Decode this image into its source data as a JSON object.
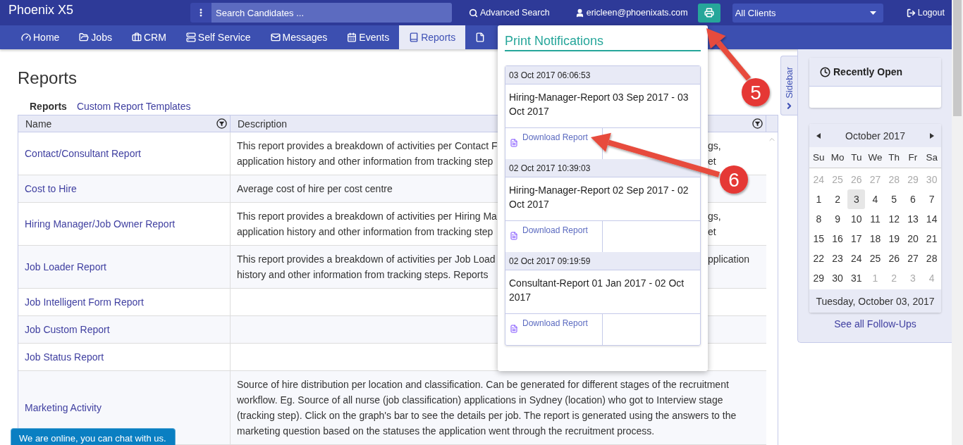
{
  "app": {
    "title": "Phoenix X5"
  },
  "top_bar": {
    "search": {
      "placeholder": "Search Candidates ..."
    },
    "advanced_search": "Advanced Search",
    "user": "ericleen@phoenixats.com",
    "client_select": {
      "value": "All Clients"
    },
    "logout": "Logout"
  },
  "nav": [
    {
      "label": "Home",
      "kind": "dashboard",
      "selected": false
    },
    {
      "label": "Jobs",
      "kind": "folder",
      "selected": false
    },
    {
      "label": "CRM",
      "kind": "briefcase",
      "selected": false
    },
    {
      "label": "Self Service",
      "kind": "server",
      "selected": false
    },
    {
      "label": "Messages",
      "kind": "mail",
      "selected": false
    },
    {
      "label": "Events",
      "kind": "calendar",
      "selected": false
    },
    {
      "label": "Reports",
      "kind": "book",
      "selected": true
    },
    {
      "kind": "file",
      "selected": false
    }
  ],
  "page": {
    "title": "Reports",
    "subtabs": [
      {
        "label": "Reports",
        "selected": true
      },
      {
        "label": "Custom Report Templates",
        "selected": false
      }
    ]
  },
  "table": {
    "columns": [
      "Name",
      "Description"
    ],
    "rows": [
      {
        "name": "Contact/Consultant Report",
        "description_fragments": [
          {
            "left": "This report provides a breakdown of activities per Contact F",
            "right": "gs,"
          },
          {
            "left": "application history and other information from tracking step",
            "right": "et"
          }
        ]
      },
      {
        "name": "Cost to Hire",
        "description": "Average cost of hire per cost centre"
      },
      {
        "name": "Hiring Manager/Job Owner Report",
        "description_fragments": [
          {
            "left": "This report provides a breakdown of activities per Hiring Ma",
            "right": "gs,"
          },
          {
            "left": "application history and other information from tracking step",
            "right": "et"
          }
        ]
      },
      {
        "name": "Job Loader Report",
        "description_fragments": [
          {
            "left": "This report provides a breakdown of activities per Job Load",
            "right": "pplication"
          },
          {
            "left": "history and other information from tracking steps. Reports"
          }
        ]
      },
      {
        "name": "Job Intelligent Form Report"
      },
      {
        "name": "Job Custom Report"
      },
      {
        "name": "Job Status Report"
      },
      {
        "name": "Marketing Activity",
        "description": "Source of hire distribution per location and classification. Can be generated for different stages of the recruitment workflow. Eg. Source of all nurse (job classification) applications in Sydney (location) who got to Interview stage (tracking step). Click on the graph's bar to see the details per job. The report is generated using the answers to the marketing question based on the statuses the application went through the recruitment process."
      }
    ]
  },
  "print_notifications": {
    "title": "Print Notifications",
    "items": [
      {
        "date": "03 Oct 2017 06:06:53",
        "title": "Hiring-Manager-Report 03 Sep 2017 - 03 Oct 2017",
        "link": "Download Report"
      },
      {
        "date": "02 Oct 2017 10:39:03",
        "title": "Hiring-Manager-Report 02 Sep 2017 - 02 Oct 2017",
        "link": "Download Report"
      },
      {
        "date": "02 Oct 2017 09:19:59",
        "title": "Consultant-Report 01 Jan 2017 - 02 Oct 2017",
        "link": "Download Report"
      }
    ]
  },
  "sidebar": {
    "tab": "Sidebar",
    "recently_open": {
      "title": "Recently Open"
    },
    "calendar": {
      "month": "October 2017",
      "weekdays": [
        "Su",
        "Mo",
        "Tu",
        "We",
        "Th",
        "Fr",
        "Sa"
      ],
      "days": [
        {
          "label": "24",
          "other_month": true,
          "selected": false
        },
        {
          "label": "25",
          "other_month": true,
          "selected": false
        },
        {
          "label": "26",
          "other_month": true,
          "selected": false
        },
        {
          "label": "27",
          "other_month": true,
          "selected": false
        },
        {
          "label": "28",
          "other_month": true,
          "selected": false
        },
        {
          "label": "29",
          "other_month": true,
          "selected": false
        },
        {
          "label": "30",
          "other_month": true,
          "selected": false
        },
        {
          "label": "1",
          "other_month": false,
          "selected": false
        },
        {
          "label": "2",
          "other_month": false,
          "selected": false
        },
        {
          "label": "3",
          "other_month": false,
          "selected": true
        },
        {
          "label": "4",
          "other_month": false,
          "selected": false
        },
        {
          "label": "5",
          "other_month": false,
          "selected": false
        },
        {
          "label": "6",
          "other_month": false,
          "selected": false
        },
        {
          "label": "7",
          "other_month": false,
          "selected": false
        },
        {
          "label": "8",
          "other_month": false,
          "selected": false
        },
        {
          "label": "9",
          "other_month": false,
          "selected": false
        },
        {
          "label": "10",
          "other_month": false,
          "selected": false
        },
        {
          "label": "11",
          "other_month": false,
          "selected": false
        },
        {
          "label": "12",
          "other_month": false,
          "selected": false
        },
        {
          "label": "13",
          "other_month": false,
          "selected": false
        },
        {
          "label": "14",
          "other_month": false,
          "selected": false
        },
        {
          "label": "15",
          "other_month": false,
          "selected": false
        },
        {
          "label": "16",
          "other_month": false,
          "selected": false
        },
        {
          "label": "17",
          "other_month": false,
          "selected": false
        },
        {
          "label": "18",
          "other_month": false,
          "selected": false
        },
        {
          "label": "19",
          "other_month": false,
          "selected": false
        },
        {
          "label": "20",
          "other_month": false,
          "selected": false
        },
        {
          "label": "21",
          "other_month": false,
          "selected": false
        },
        {
          "label": "22",
          "other_month": false,
          "selected": false
        },
        {
          "label": "23",
          "other_month": false,
          "selected": false
        },
        {
          "label": "24",
          "other_month": false,
          "selected": false
        },
        {
          "label": "25",
          "other_month": false,
          "selected": false
        },
        {
          "label": "26",
          "other_month": false,
          "selected": false
        },
        {
          "label": "27",
          "other_month": false,
          "selected": false
        },
        {
          "label": "28",
          "other_month": false,
          "selected": false
        },
        {
          "label": "29",
          "other_month": false,
          "selected": false
        },
        {
          "label": "30",
          "other_month": false,
          "selected": false
        },
        {
          "label": "31",
          "other_month": false,
          "selected": false
        },
        {
          "label": "1",
          "other_month": true,
          "selected": false
        },
        {
          "label": "2",
          "other_month": true,
          "selected": false
        },
        {
          "label": "3",
          "other_month": true,
          "selected": false
        },
        {
          "label": "4",
          "other_month": true,
          "selected": false
        }
      ],
      "footer": "Tuesday, October 03, 2017"
    },
    "follow_ups_link": "See all Follow-Ups"
  },
  "chat": {
    "text": "We are online, you can chat with us."
  },
  "annotations": [
    {
      "number": "5"
    },
    {
      "number": "6"
    }
  ]
}
